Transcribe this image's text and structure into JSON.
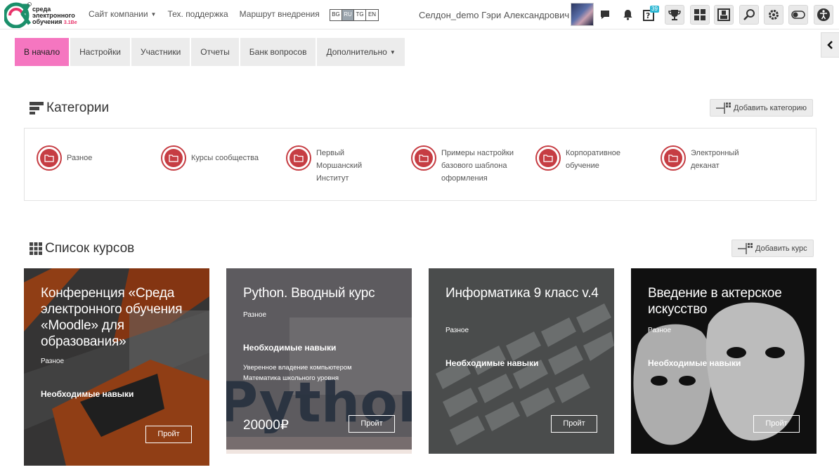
{
  "topbar": {
    "logo_line1": "среда",
    "logo_line2": "электронного",
    "logo_line3": "обучения",
    "logo_edition": "3.1Be",
    "nav": [
      {
        "label": "Сайт компании",
        "dropdown": true
      },
      {
        "label": "Тех. поддержка",
        "dropdown": false
      },
      {
        "label": "Маршрут внедрения",
        "dropdown": false
      }
    ],
    "languages": [
      {
        "code": "BG",
        "active": false
      },
      {
        "code": "RU",
        "active": true
      },
      {
        "code": "TG",
        "active": false
      },
      {
        "code": "EN",
        "active": false
      }
    ],
    "user_name": "Селдон_demo Гэри Александрович",
    "icons": [
      "chat-icon",
      "bell-icon",
      "question-icon",
      "trophy-icon",
      "dashboard-icon",
      "grades-icon",
      "search-icon",
      "gear-icon",
      "toggle-icon",
      "accessibility-icon"
    ],
    "question_badge": "39"
  },
  "secondary_nav": {
    "tabs": [
      {
        "label": "В начало",
        "active": true
      },
      {
        "label": "Настройки",
        "active": false
      },
      {
        "label": "Участники",
        "active": false
      },
      {
        "label": "Отчеты",
        "active": false
      },
      {
        "label": "Банк вопросов",
        "active": false
      },
      {
        "label": "Дополнительно",
        "active": false,
        "dropdown": true
      }
    ]
  },
  "categories": {
    "title": "Категории",
    "add_button": "Добавить категорию",
    "items": [
      {
        "label": "Разное"
      },
      {
        "label": "Курсы сообщества"
      },
      {
        "label": "Первый Моршанский Институт"
      },
      {
        "label": "Примеры настройки базового шаблона оформления"
      },
      {
        "label": "Корпоративное обучение"
      },
      {
        "label": "Электронный деканат"
      }
    ]
  },
  "courses": {
    "title": "Список курсов",
    "add_button": "Добавить курс",
    "cards": [
      {
        "title": "Конференция «Среда электронного обучения «Moodle» для образования»",
        "category": "Разное",
        "skills_label": "Необходимые навыки",
        "skills": [],
        "price": "",
        "button": "Пройт"
      },
      {
        "title": "Python. Вводный курс",
        "category": "Разное",
        "skills_label": "Необходимые навыки",
        "skills": [
          "Уверенное владение компьютером",
          "Математика школьного уровня"
        ],
        "price": "20000₽",
        "button": "Пройт"
      },
      {
        "title": "Информатика 9 класс v.4",
        "category": "Разное",
        "skills_label": "Необходимые навыки",
        "skills": [],
        "price": "",
        "button": "Пройт"
      },
      {
        "title": "Введение в актерское искусство",
        "category": "Разное",
        "skills_label": "Необходимые навыки",
        "skills": [],
        "price": "",
        "button": "Пройт"
      }
    ]
  },
  "colors": {
    "accent_pink": "#f576c0",
    "category_red": "#c63d43",
    "badge_blue": "#2db7d3"
  }
}
